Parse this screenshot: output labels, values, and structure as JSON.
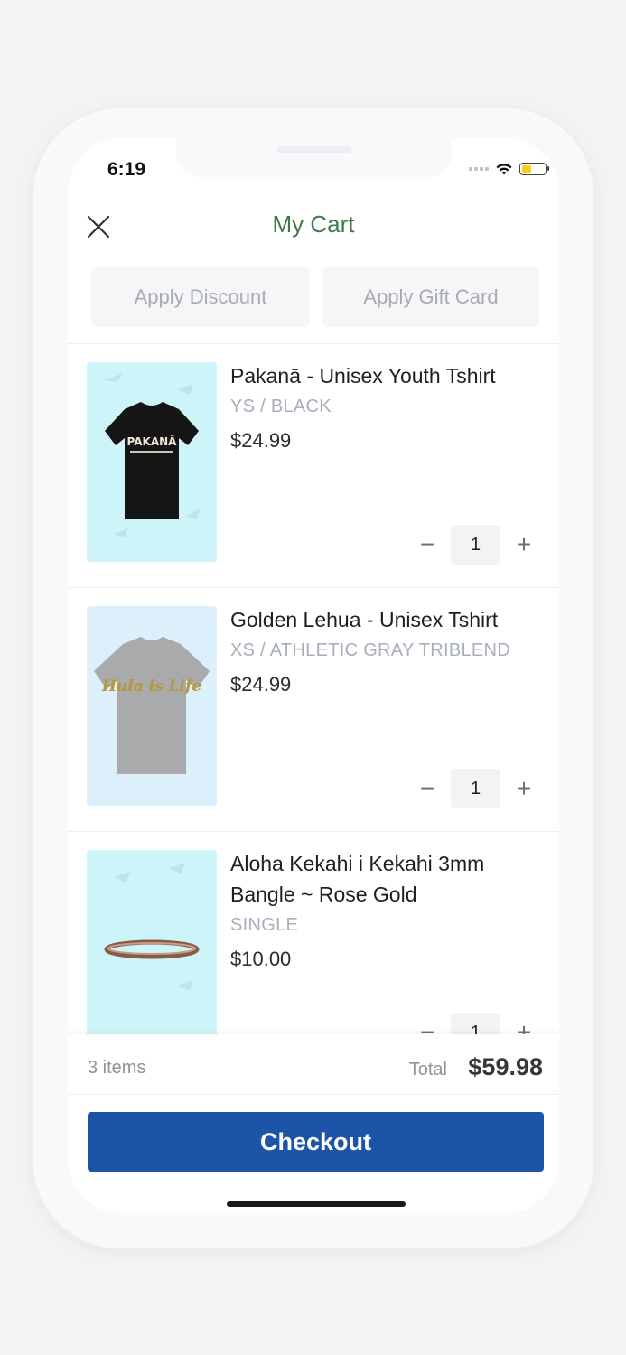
{
  "status_bar": {
    "time": "6:19"
  },
  "header": {
    "title": "My Cart"
  },
  "actions": {
    "discount_label": "Apply Discount",
    "gift_card_label": "Apply Gift Card"
  },
  "items": [
    {
      "name": "Pakanā - Unisex Youth Tshirt",
      "variant": "YS / BLACK",
      "price": "$24.99",
      "quantity": "1",
      "image_text": "PAKANĀ"
    },
    {
      "name": "Golden Lehua - Unisex Tshirt",
      "variant": "XS / ATHLETIC GRAY TRIBLEND",
      "price": "$24.99",
      "quantity": "1",
      "image_text": "Hula is Life"
    },
    {
      "name": "Aloha Kekahi i Kekahi 3mm Bangle ~ Rose Gold",
      "variant": "SINGLE",
      "price": "$10.00",
      "quantity": "1"
    }
  ],
  "summary": {
    "item_count": "3 items",
    "total_label": "Total",
    "total_value": "$59.98",
    "checkout_label": "Checkout"
  },
  "colors": {
    "brand_green": "#3f7a4a",
    "checkout_blue": "#1c54a8",
    "battery_yellow": "#f7d11a"
  },
  "icons": {
    "close": "close-icon",
    "minus": "minus-icon",
    "plus": "plus-icon",
    "wifi": "wifi-icon",
    "battery": "battery-icon"
  }
}
